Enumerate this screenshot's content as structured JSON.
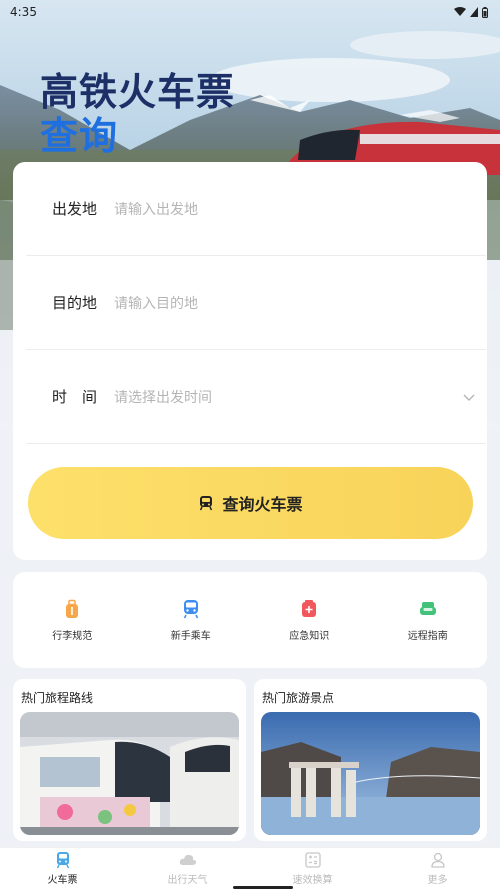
{
  "status_bar": {
    "time": "4:35"
  },
  "hero": {
    "title_line1": "高铁火车票",
    "title_line2": "查询"
  },
  "form": {
    "departure": {
      "label": "出发地",
      "placeholder": "请输入出发地"
    },
    "destination": {
      "label": "目的地",
      "placeholder": "请输入目的地"
    },
    "date": {
      "label": "时　间",
      "placeholder": "请选择出发时间"
    },
    "submit_label": "查询火车票"
  },
  "quick_menu": [
    {
      "label": "行李规范",
      "icon": "luggage-icon",
      "color": "#f7a64a"
    },
    {
      "label": "新手乘车",
      "icon": "train-icon",
      "color": "#3d8ef0"
    },
    {
      "label": "应急知识",
      "icon": "first-aid-icon",
      "color": "#f0585e"
    },
    {
      "label": "远程指南",
      "icon": "sofa-icon",
      "color": "#43c27a"
    }
  ],
  "hot_sections": {
    "routes_title": "热门旅程路线",
    "spots_title": "热门旅游景点"
  },
  "bottom_nav": [
    {
      "label": "火车票",
      "icon": "train-ticket-icon",
      "active": true
    },
    {
      "label": "出行天气",
      "icon": "cloud-icon",
      "active": false
    },
    {
      "label": "速效换算",
      "icon": "calculator-icon",
      "active": false
    },
    {
      "label": "更多",
      "icon": "person-icon",
      "active": false
    }
  ],
  "colors": {
    "accent_yellow": "#fcd95c",
    "title_dark": "#1c2f67",
    "title_blue": "#1e6fe0"
  }
}
